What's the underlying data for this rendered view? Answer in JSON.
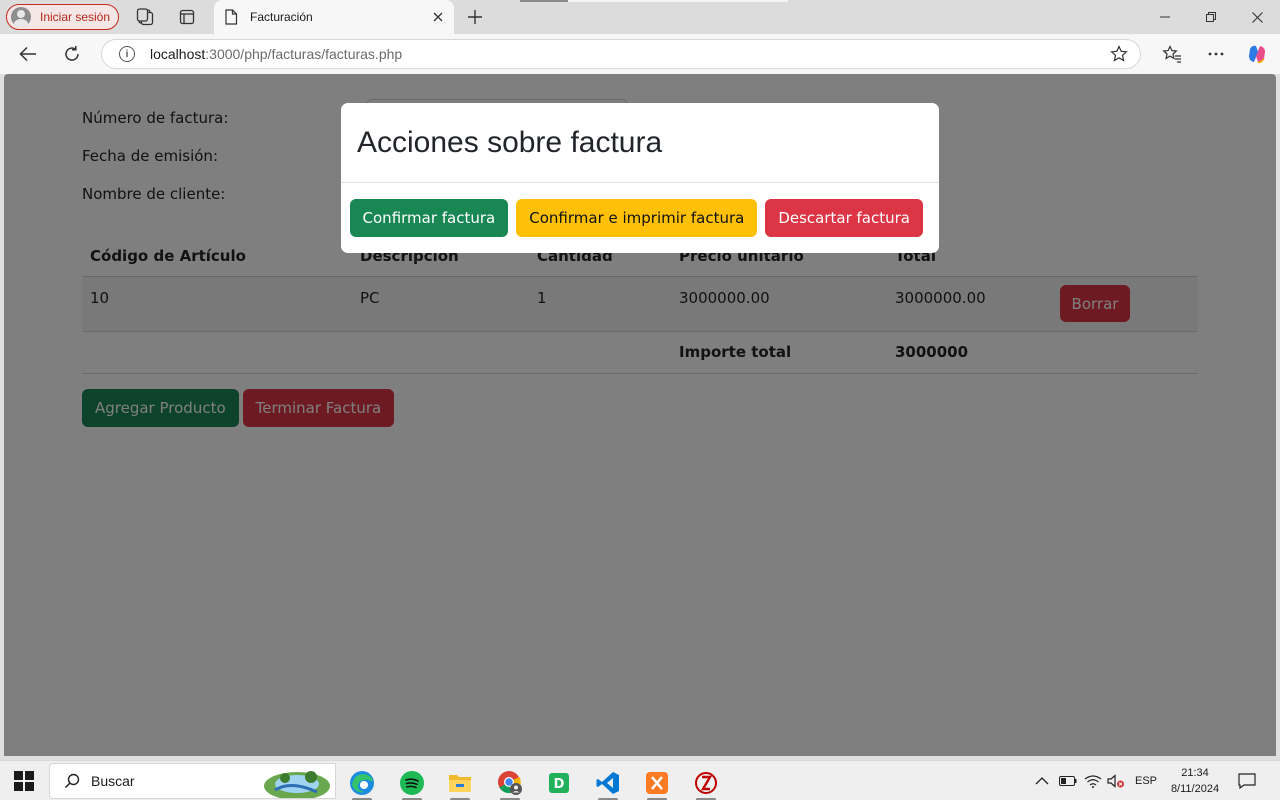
{
  "browser": {
    "profile_label": "Iniciar sesión",
    "tab_title": "Facturación",
    "url_host": "localhost",
    "url_rest": ":3000/php/facturas/facturas.php"
  },
  "form": {
    "numero_label": "Número de factura:",
    "fecha_label": "Fecha de emisión:",
    "cliente_label": "Nombre de cliente:"
  },
  "table": {
    "headers": [
      "Código de Artículo",
      "Descripcion",
      "Cantidad",
      "Precio unitario",
      "Total"
    ],
    "rows": [
      {
        "codigo": "10",
        "descripcion": "PC",
        "cantidad": "1",
        "precio": "3000000.00",
        "total": "3000000.00",
        "delete_label": "Borrar"
      }
    ],
    "total_label": "Importe total",
    "total_value": "3000000"
  },
  "actions": {
    "add_label": "Agregar Producto",
    "finish_label": "Terminar Factura"
  },
  "modal": {
    "title": "Acciones sobre factura",
    "confirm_label": "Confirmar factura",
    "confirm_print_label": "Confirmar e imprimir factura",
    "discard_label": "Descartar factura"
  },
  "taskbar": {
    "search_label": "Buscar",
    "lang": "ESP",
    "time": "21:34",
    "date": "8/11/2024",
    "apps": [
      "edge-icon",
      "spotify-icon",
      "file-explorer-icon",
      "chrome-icon",
      "dbeaver-icon",
      "vscode-icon",
      "xampp-icon",
      "filezilla-icon"
    ]
  },
  "colors": {
    "success": "#198754",
    "warning": "#ffc107",
    "danger": "#dc3545",
    "profile_accent": "#c42b1c"
  }
}
